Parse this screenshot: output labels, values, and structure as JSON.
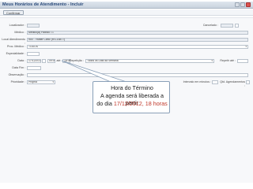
{
  "window": {
    "title": "Meus Horários de Atendimento - Incluir",
    "close_icon": "close-icon",
    "min_icon": "minimize-icon",
    "max_icon": "maximize-icon"
  },
  "toolbar": {
    "confirm_label": "Confirmar"
  },
  "form": {
    "localizador_label": "Localizador :",
    "localizador_value": "",
    "cancelado_label": "Cancelado :",
    "medico_label": "Médico :",
    "medico_value": "Médico(a) Padrão T.I.",
    "local_label": "Local Atendimento :",
    "local_value": "900 - Twitter Clinic (RS-15877)",
    "proc_label": "Proc. Médico :",
    "proc_value": "TODOS",
    "especialidade_label": "Especialidade :",
    "especialidade_value": "",
    "data_label": "Data :",
    "data_value": "17/12/2012",
    "hora_inicio": "09:00",
    "ate_label": "até",
    "hora_fim": "18:00",
    "repeticao_label": "Repetição :",
    "repeticao_value": "Todos os Dias da Semana",
    "repetir_ate_label": "Repetir até :",
    "data_fim_label": "Data Fim :",
    "observacao_label": "Observação :",
    "prioridade_label": "Prioridade :",
    "prioridade_value": "Própria",
    "encaixe_label": "Intervalo em minutos :",
    "qtd_label": "Qtd. Agendamentos :"
  },
  "tooltip": {
    "line1": "Hora do Término",
    "line2": "A agenda será liberada a partir",
    "line3_prefix": "do dia",
    "line3_date": "17/12/2012, 18 horas"
  }
}
